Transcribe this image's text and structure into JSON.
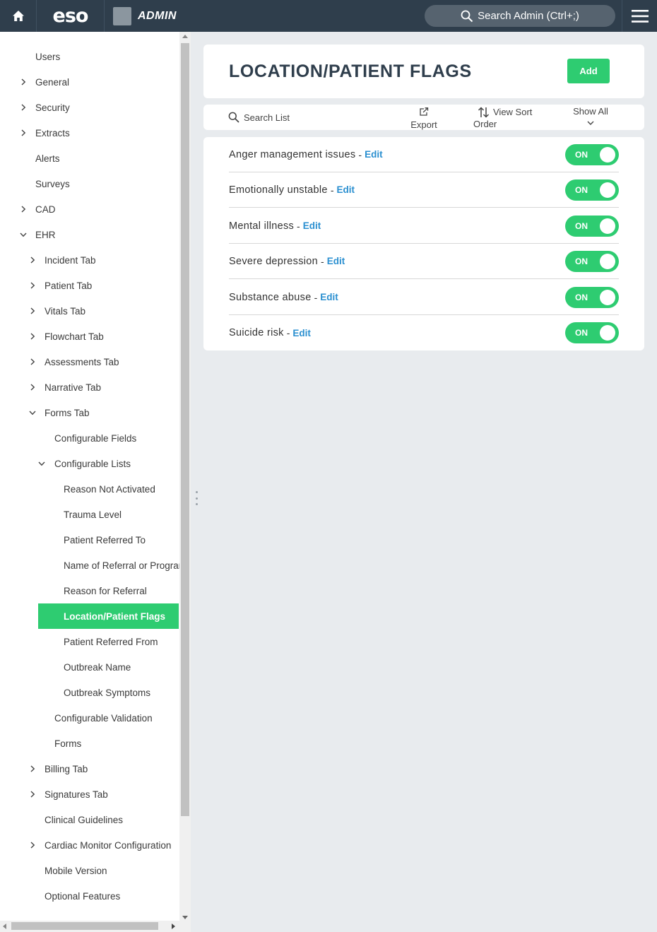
{
  "topbar": {
    "logo": "eso",
    "admin_label": "ADMIN",
    "search_placeholder": "Search Admin (Ctrl+;)",
    "icons": [
      "home-icon",
      "search-icon",
      "hamburger-menu-icon"
    ]
  },
  "sidebar": {
    "items": [
      {
        "label": "Users",
        "level": 0,
        "chevron": "none"
      },
      {
        "label": "General",
        "level": 0,
        "chevron": "right"
      },
      {
        "label": "Security",
        "level": 0,
        "chevron": "right"
      },
      {
        "label": "Extracts",
        "level": 0,
        "chevron": "right"
      },
      {
        "label": "Alerts",
        "level": 0,
        "chevron": "none"
      },
      {
        "label": "Surveys",
        "level": 0,
        "chevron": "none"
      },
      {
        "label": "CAD",
        "level": 0,
        "chevron": "right"
      },
      {
        "label": "EHR",
        "level": 0,
        "chevron": "down"
      },
      {
        "label": "Incident Tab",
        "level": 1,
        "chevron": "right"
      },
      {
        "label": "Patient Tab",
        "level": 1,
        "chevron": "right"
      },
      {
        "label": "Vitals Tab",
        "level": 1,
        "chevron": "right"
      },
      {
        "label": "Flowchart Tab",
        "level": 1,
        "chevron": "right"
      },
      {
        "label": "Assessments Tab",
        "level": 1,
        "chevron": "right"
      },
      {
        "label": "Narrative Tab",
        "level": 1,
        "chevron": "right"
      },
      {
        "label": "Forms Tab",
        "level": 1,
        "chevron": "down"
      },
      {
        "label": "Configurable Fields",
        "level": 2,
        "chevron": "none"
      },
      {
        "label": "Configurable Lists",
        "level": 2,
        "chevron": "down"
      },
      {
        "label": "Reason Not Activated",
        "level": 3,
        "chevron": "none"
      },
      {
        "label": "Trauma Level",
        "level": 3,
        "chevron": "none"
      },
      {
        "label": "Patient Referred To",
        "level": 3,
        "chevron": "none"
      },
      {
        "label": "Name of Referral or Prograr",
        "level": 3,
        "chevron": "none"
      },
      {
        "label": "Reason for Referral",
        "level": 3,
        "chevron": "none"
      },
      {
        "label": "Location/Patient Flags",
        "level": 3,
        "chevron": "none",
        "active": true
      },
      {
        "label": "Patient Referred From",
        "level": 3,
        "chevron": "none"
      },
      {
        "label": "Outbreak Name",
        "level": 3,
        "chevron": "none"
      },
      {
        "label": "Outbreak Symptoms",
        "level": 3,
        "chevron": "none"
      },
      {
        "label": "Configurable Validation",
        "level": 2,
        "chevron": "none"
      },
      {
        "label": "Forms",
        "level": 2,
        "chevron": "none"
      },
      {
        "label": "Billing Tab",
        "level": 1,
        "chevron": "right"
      },
      {
        "label": "Signatures Tab",
        "level": 1,
        "chevron": "right"
      },
      {
        "label": "Clinical Guidelines",
        "level": 1,
        "chevron": "none"
      },
      {
        "label": "Cardiac Monitor Configuration",
        "level": 1,
        "chevron": "right"
      },
      {
        "label": "Mobile Version",
        "level": 1,
        "chevron": "none"
      },
      {
        "label": "Optional Features",
        "level": 1,
        "chevron": "none"
      }
    ]
  },
  "main": {
    "title": "LOCATION/PATIENT FLAGS",
    "add_label": "Add",
    "toolbar": {
      "search_label": "Search List",
      "export_label": "Export",
      "view_sort_label": "View Sort",
      "view_sort_label_2": "Order",
      "show_all_label": "Show All"
    },
    "flags": [
      {
        "name": "Anger management issues",
        "edit_label": "Edit",
        "toggle_label": "ON"
      },
      {
        "name": "Emotionally unstable",
        "edit_label": "Edit",
        "toggle_label": "ON"
      },
      {
        "name": "Mental illness",
        "edit_label": "Edit",
        "toggle_label": "ON"
      },
      {
        "name": "Severe depression",
        "edit_label": "Edit",
        "toggle_label": "ON"
      },
      {
        "name": "Substance abuse",
        "edit_label": "Edit",
        "toggle_label": "ON"
      },
      {
        "name": "Suicide risk",
        "edit_label": "Edit",
        "toggle_label": "ON"
      }
    ]
  },
  "colors": {
    "topbar": "#2f3e4c",
    "accent_green": "#2ecc71",
    "link_blue": "#2a8fd0",
    "background": "#e8ebee"
  }
}
